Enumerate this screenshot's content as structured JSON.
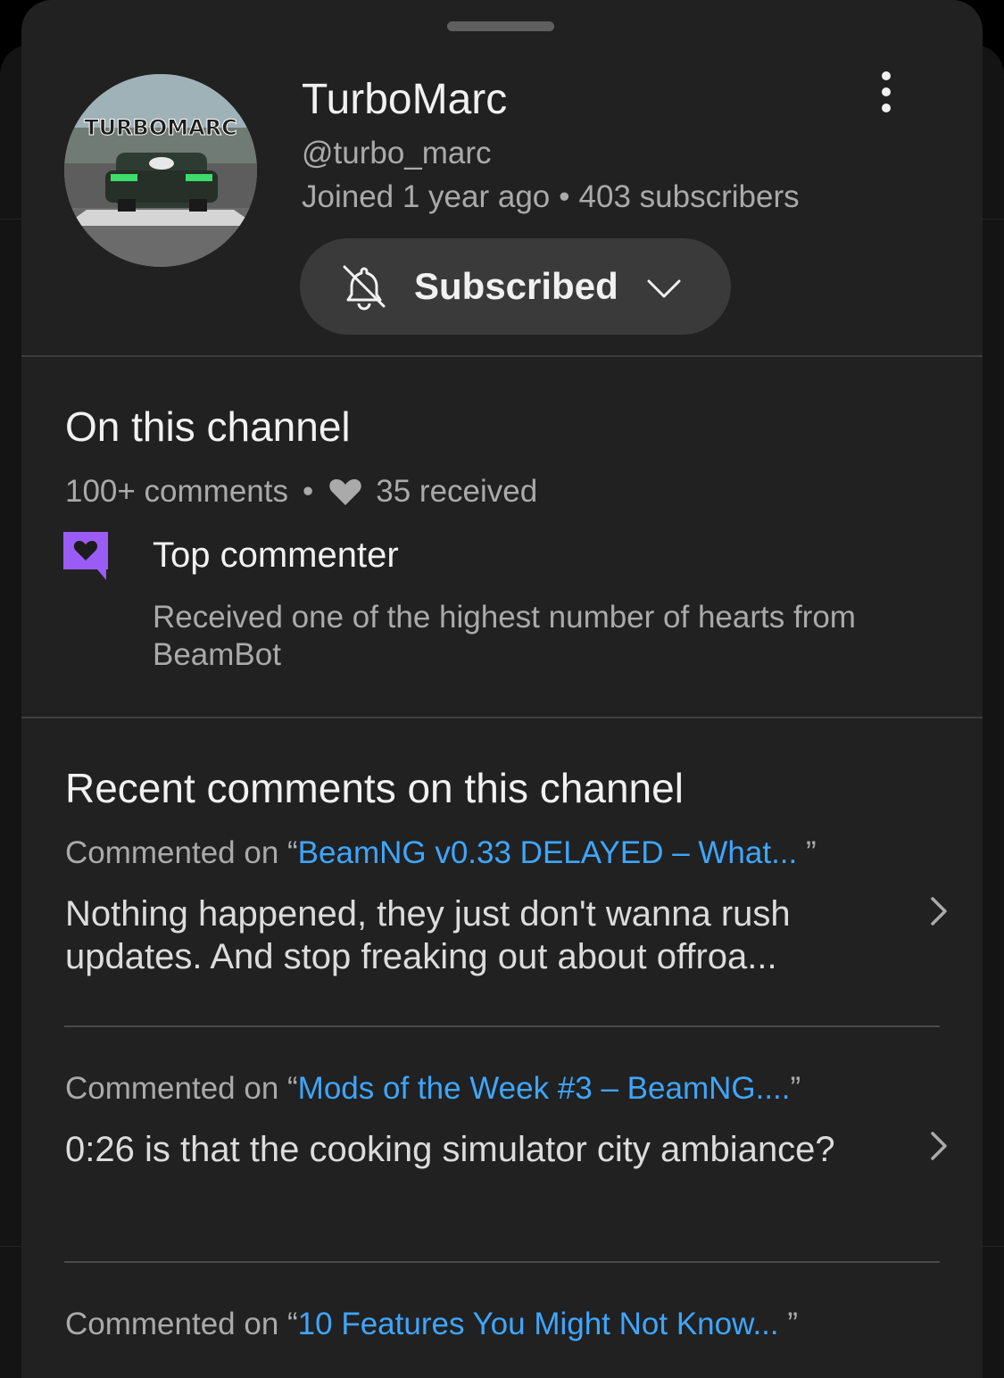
{
  "profile": {
    "name": "TurboMarc",
    "handle": "@turbo_marc",
    "joined": "Joined 1 year ago",
    "subscribers": "403 subscribers",
    "meta_separator": "•",
    "subscribe_label": "Subscribed",
    "avatar_text": "TURBOMARC"
  },
  "channel_activity": {
    "title": "On this channel",
    "comments_count": "100+ comments",
    "separator": "•",
    "hearts_received": "35 received",
    "badge": {
      "title": "Top commenter",
      "description": "Received one of the highest number of hearts from BeamBot",
      "color": "#9b5cf6"
    }
  },
  "recent_comments": {
    "title": "Recent comments on this channel",
    "items": [
      {
        "prefix": "Commented on “",
        "video_title": "BeamNG v0.33 DELAYED – What...",
        "suffix": " ”",
        "text": "Nothing happened, they just don't wanna rush updates. And stop freaking out about offroa..."
      },
      {
        "prefix": "Commented on “",
        "video_title": "Mods of the Week #3 – BeamNG....",
        "suffix": "”",
        "text": "0:26 is that the cooking simulator city ambiance?"
      },
      {
        "prefix": "Commented on “",
        "video_title": "10 Features You Might Not Know...",
        "suffix": " ”",
        "text": ""
      }
    ]
  },
  "colors": {
    "sheet_bg": "#212121",
    "link": "#3ea6ff",
    "button_bg": "#3a3a3a",
    "secondary_text": "#aaaaaa"
  },
  "icons": {
    "bell": "notifications-off-icon",
    "chevron": "chevron-down-icon",
    "more": "more-vertical-icon",
    "heart": "heart-icon",
    "badge": "heart-comment-badge-icon",
    "arrow": "chevron-right-icon"
  }
}
